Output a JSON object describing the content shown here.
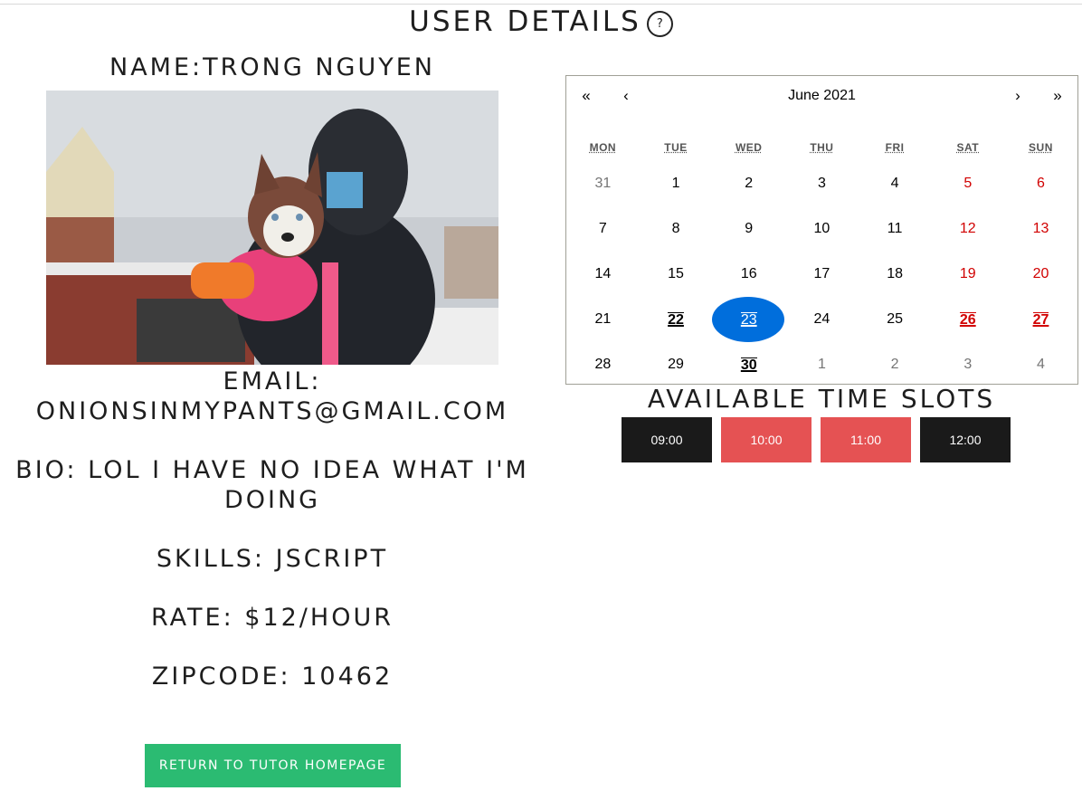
{
  "header": {
    "title": "USER DETAILS",
    "help_label": "?"
  },
  "profile": {
    "name": "NAME:TRONG NGUYEN",
    "email_label": "EMAIL:",
    "email": "ONIONSINMYPANTS@GMAIL.COM",
    "bio": "BIO: LOL I HAVE NO IDEA WHAT I'M DOING",
    "skills": "SKILLS: JSCRIPT",
    "rate": "RATE: $12/HOUR",
    "zipcode": "ZIPCODE: 10462",
    "return_button": "RETURN TO TUTOR HOMEPAGE"
  },
  "calendar": {
    "prev2": "«",
    "prev": "‹",
    "label": "June 2021",
    "next": "›",
    "next2": "»",
    "weekdays": [
      "MON",
      "TUE",
      "WED",
      "THU",
      "FRI",
      "SAT",
      "SUN"
    ],
    "days": [
      {
        "d": "31",
        "t": "neighbor"
      },
      {
        "d": "1"
      },
      {
        "d": "2"
      },
      {
        "d": "3"
      },
      {
        "d": "4"
      },
      {
        "d": "5",
        "t": "weekend"
      },
      {
        "d": "6",
        "t": "weekend"
      },
      {
        "d": "7"
      },
      {
        "d": "8"
      },
      {
        "d": "9"
      },
      {
        "d": "10"
      },
      {
        "d": "11"
      },
      {
        "d": "12",
        "t": "weekend"
      },
      {
        "d": "13",
        "t": "weekend"
      },
      {
        "d": "14"
      },
      {
        "d": "15"
      },
      {
        "d": "16"
      },
      {
        "d": "17"
      },
      {
        "d": "18"
      },
      {
        "d": "19",
        "t": "weekend"
      },
      {
        "d": "20",
        "t": "weekend"
      },
      {
        "d": "21"
      },
      {
        "d": "22",
        "m": true
      },
      {
        "d": "23",
        "t": "active",
        "m": true
      },
      {
        "d": "24"
      },
      {
        "d": "25"
      },
      {
        "d": "26",
        "t": "weekend",
        "m": true
      },
      {
        "d": "27",
        "t": "weekend",
        "m": true
      },
      {
        "d": "28"
      },
      {
        "d": "29"
      },
      {
        "d": "30",
        "m": true
      },
      {
        "d": "1",
        "t": "neighbor"
      },
      {
        "d": "2",
        "t": "neighbor"
      },
      {
        "d": "3",
        "t": "neighbor"
      },
      {
        "d": "4",
        "t": "neighbor"
      }
    ]
  },
  "slots": {
    "title": "AVAILABLE TIME SLOTS",
    "items": [
      {
        "label": "09:00",
        "style": "dark"
      },
      {
        "label": "10:00",
        "style": "red"
      },
      {
        "label": "11:00",
        "style": "red"
      },
      {
        "label": "12:00",
        "style": "dark"
      }
    ]
  },
  "colors": {
    "accent_green": "#2bbb72",
    "slot_red": "#e55253",
    "slot_dark": "#1a1a1a",
    "selected_blue": "#006edc",
    "weekend_red": "#d10000"
  }
}
